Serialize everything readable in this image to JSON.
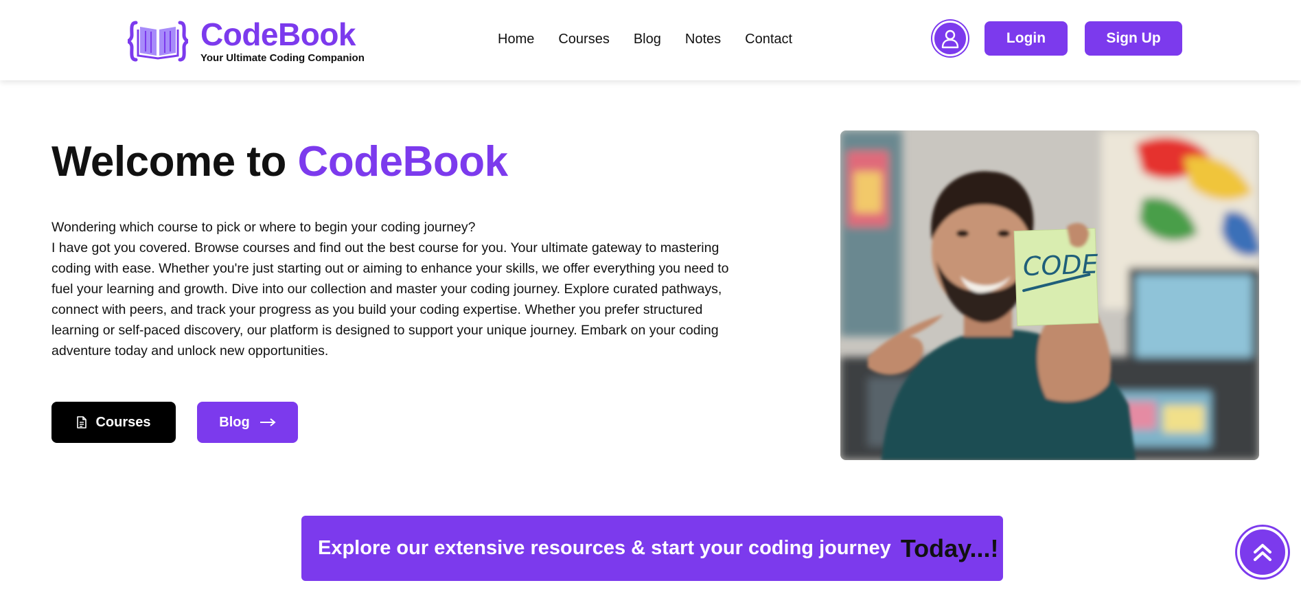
{
  "brand": {
    "name": "CodeBook",
    "tagline": "Your Ultimate Coding Companion",
    "accent_color": "#7c3aed"
  },
  "nav": {
    "items": [
      {
        "label": "Home"
      },
      {
        "label": "Courses"
      },
      {
        "label": "Blog"
      },
      {
        "label": "Notes"
      },
      {
        "label": "Contact"
      }
    ]
  },
  "header_actions": {
    "avatar_icon": "user-icon",
    "login_label": "Login",
    "signup_label": "Sign Up"
  },
  "hero": {
    "title_prefix": "Welcome to",
    "title_accent": "CodeBook",
    "intro_line": "Wondering which course to pick or where to begin your coding journey?",
    "body": "I have got you covered. Browse courses and find out the best course for you. Your ultimate gateway to mastering coding with ease. Whether you're just starting out or aiming to enhance your skills, we offer everything you need to fuel your learning and growth. Dive into our collection and master your coding journey. Explore curated pathways, connect with peers, and track your progress as you build your coding expertise. Whether you prefer structured learning or self-paced discovery, our platform is designed to support your unique journey. Embark on your coding adventure today and unlock new opportunities.",
    "courses_button": "Courses",
    "courses_icon": "document-icon",
    "blog_button": "Blog",
    "blog_icon": "arrow-right-icon",
    "image_note_text": "CODE"
  },
  "banner": {
    "text": "Explore our extensive resources & start your coding journey",
    "emphasis": "Today...!"
  },
  "scroll_top_icon": "double-chevron-up-icon"
}
